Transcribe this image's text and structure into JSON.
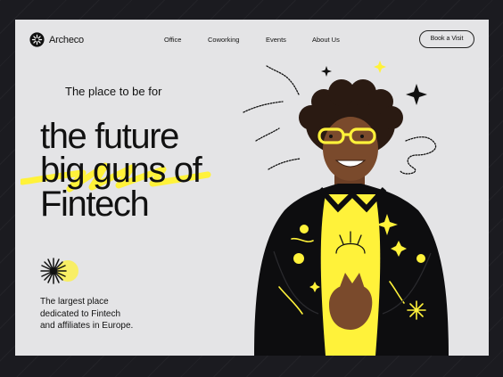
{
  "nav": {
    "logo_text": "Archeco",
    "items": [
      "Office",
      "Coworking",
      "Events",
      "About Us"
    ],
    "cta_label": "Book a Visit"
  },
  "hero": {
    "tagline": "The place to be for",
    "headline": [
      "the future",
      "big guns of",
      "Fintech"
    ],
    "description": [
      "The largest place",
      "dedicated to Fintech",
      "and affiliates in Europe."
    ]
  },
  "colors": {
    "accent": "#fff23a",
    "background": "#e4e4e6",
    "frame": "#1b1b20",
    "text": "#111111"
  }
}
